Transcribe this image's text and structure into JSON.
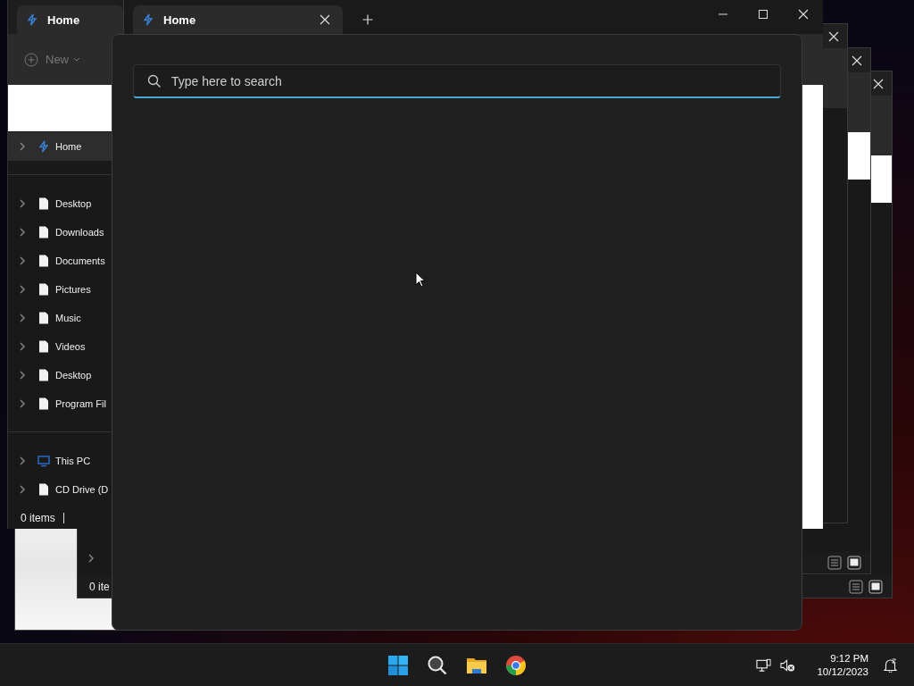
{
  "explorer": {
    "tabs": [
      {
        "label": "Home",
        "selected": true
      }
    ],
    "toolbar": {
      "new_label": "New"
    },
    "sidebar": {
      "groups": [
        {
          "items": [
            {
              "label": "Home",
              "kind": "home",
              "selected": true
            }
          ]
        },
        {
          "items": [
            {
              "label": "Desktop",
              "kind": "file",
              "selected": false
            },
            {
              "label": "Downloads",
              "kind": "file",
              "selected": false
            },
            {
              "label": "Documents",
              "kind": "file",
              "selected": false
            },
            {
              "label": "Pictures",
              "kind": "file",
              "selected": false
            },
            {
              "label": "Music",
              "kind": "file",
              "selected": false
            },
            {
              "label": "Videos",
              "kind": "file",
              "selected": false
            },
            {
              "label": "Desktop",
              "kind": "file",
              "selected": false
            },
            {
              "label": "Program Fil",
              "kind": "file",
              "selected": false
            }
          ]
        },
        {
          "items": [
            {
              "label": "This PC",
              "kind": "pc",
              "selected": false
            },
            {
              "label": "CD Drive (D",
              "kind": "file",
              "selected": false
            }
          ]
        }
      ]
    },
    "status": "0 items"
  },
  "front_window": {
    "tabs": [
      {
        "label": "Home",
        "selected": true
      }
    ]
  },
  "background_window": {
    "status": "0 ite"
  },
  "search_popup": {
    "placeholder": "Type here to search",
    "focused": true
  },
  "taskbar": {
    "apps": [
      {
        "kind": "start"
      },
      {
        "kind": "search"
      },
      {
        "kind": "files"
      },
      {
        "kind": "browser"
      }
    ],
    "tray": [
      {
        "kind": "network"
      },
      {
        "kind": "volume-muted"
      }
    ],
    "time": "9:12 PM",
    "date": "10/12/2023"
  }
}
